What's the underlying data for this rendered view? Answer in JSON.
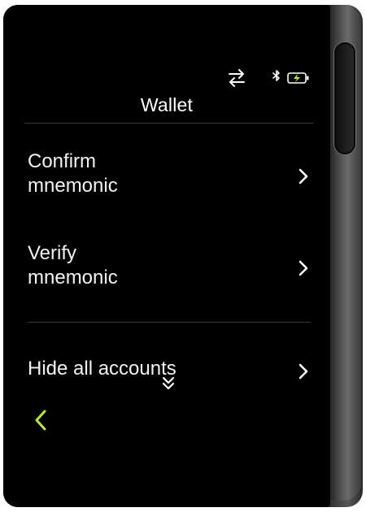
{
  "header": {
    "title": "Wallet",
    "status_icons": [
      "transfer-icon",
      "bluetooth-icon",
      "battery-charging-icon"
    ]
  },
  "menu": {
    "items": [
      {
        "label": "Confirm\nmnemonic",
        "icon": "chevron-right-icon"
      },
      {
        "label": "Verify\nmnemonic",
        "icon": "chevron-right-icon"
      },
      {
        "label": "Hide all accounts",
        "icon": "chevron-right-icon"
      }
    ]
  },
  "footer": {
    "back_icon": "chevron-left-icon",
    "scroll_icon": "double-chevron-down-icon"
  },
  "colors": {
    "background": "#000000",
    "text": "#f2f2f2",
    "accent": "#b8e83a",
    "divider": "#3a3a3a"
  }
}
